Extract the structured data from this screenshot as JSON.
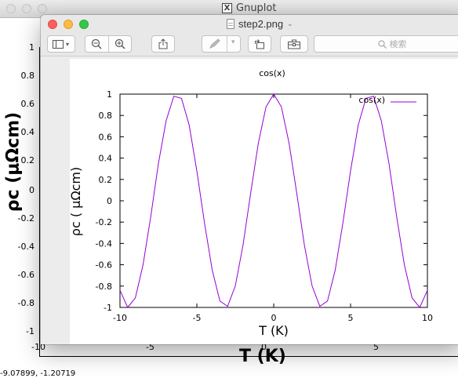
{
  "background_window": {
    "title": "Gnuplot",
    "y_ticks": [
      "1",
      "0.8",
      "0.6",
      "0.4",
      "0.2",
      "0",
      "-0.2",
      "-0.4",
      "-0.6",
      "-0.8",
      "-1"
    ],
    "x_ticks": [
      "-10",
      "-5",
      "0",
      "5"
    ],
    "ylabel": "ρc (μΩcm)",
    "xlabel": "T (K)",
    "coords": "-9.07899, -1.20719"
  },
  "preview_window": {
    "title": "step2.png",
    "search_placeholder": "検索"
  },
  "toolbar": {
    "sidebar_icon": "sidebar-toggle-icon",
    "zoom_out_icon": "zoom-out-icon",
    "zoom_in_icon": "zoom-in-icon",
    "share_icon": "share-icon",
    "markup_icon": "pen-icon",
    "rotate_icon": "rotate-icon",
    "toolbox_icon": "toolbox-icon"
  },
  "chart_data": {
    "type": "line",
    "title": "cos(x)",
    "xlabel": "T (K)",
    "ylabel": "ρc ( μΩcm)",
    "xlim": [
      -10,
      10
    ],
    "ylim": [
      -1,
      1
    ],
    "x_ticks": [
      "-10",
      "-5",
      "0",
      "5",
      "10"
    ],
    "y_ticks": [
      "1",
      "0.8",
      "0.6",
      "0.4",
      "0.2",
      "0",
      "-0.2",
      "-0.4",
      "-0.6",
      "-0.8",
      "-1"
    ],
    "legend_position": "top-right",
    "grid": false,
    "series": [
      {
        "name": "cos(x)",
        "color": "#9400d3",
        "x": [
          -10,
          -9.5,
          -9,
          -8.5,
          -8,
          -7.5,
          -7,
          -6.5,
          -6,
          -5.5,
          -5,
          -4.5,
          -4,
          -3.5,
          -3,
          -2.5,
          -2,
          -1.5,
          -1,
          -0.5,
          0,
          0.5,
          1,
          1.5,
          2,
          2.5,
          3,
          3.5,
          4,
          4.5,
          5,
          5.5,
          6,
          6.5,
          7,
          7.5,
          8,
          8.5,
          9,
          9.5,
          10
        ],
        "y": [
          -0.84,
          -1.0,
          -0.91,
          -0.6,
          -0.15,
          0.35,
          0.75,
          0.98,
          0.96,
          0.71,
          0.28,
          -0.21,
          -0.65,
          -0.94,
          -0.99,
          -0.8,
          -0.42,
          0.07,
          0.54,
          0.88,
          1.0,
          0.88,
          0.54,
          0.07,
          -0.42,
          -0.8,
          -0.99,
          -0.94,
          -0.65,
          -0.21,
          0.28,
          0.71,
          0.96,
          0.98,
          0.75,
          0.35,
          -0.15,
          -0.6,
          -0.91,
          -1.0,
          -0.84
        ]
      }
    ]
  }
}
